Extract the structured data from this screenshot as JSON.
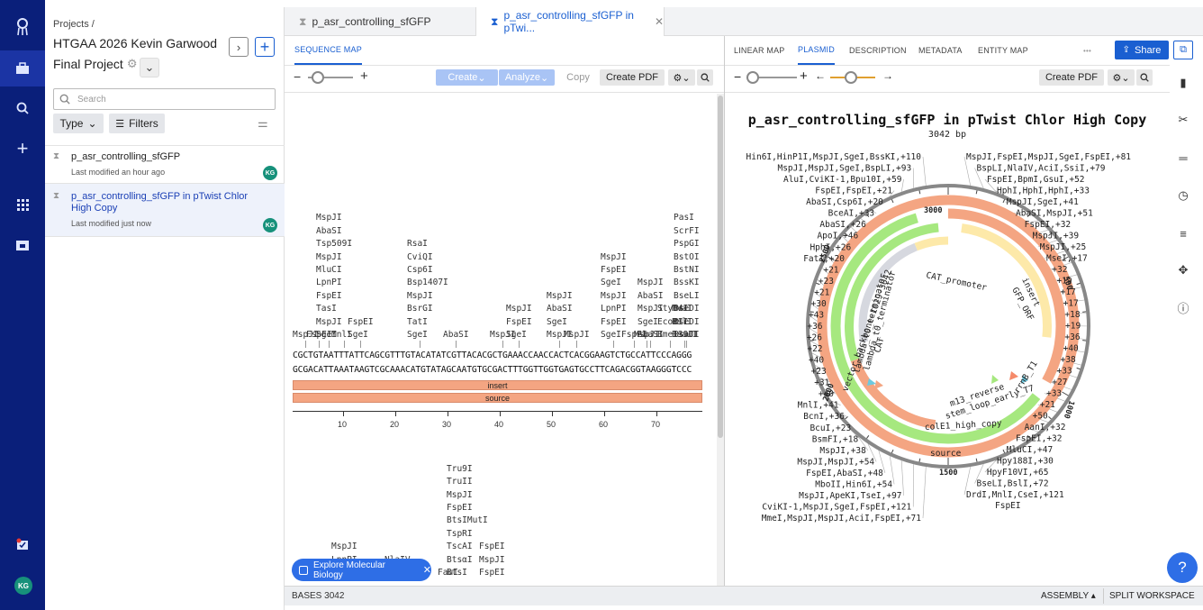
{
  "nav": {
    "items": [
      "logo-icon",
      "briefcase-icon",
      "search-icon",
      "plus-icon",
      "apps-icon",
      "folder-icon"
    ],
    "bottom_badge": "KG"
  },
  "project": {
    "breadcrumb": "Projects /",
    "title_line1": "HTGAA 2026 Kevin Garwood",
    "title_line2": "Final Project",
    "search_placeholder": "Search",
    "type_label": "Type",
    "filters_label": "Filters",
    "files": [
      {
        "name": "p_asr_controlling_sfGFP",
        "modified": "Last modified an hour ago",
        "owner": "KG"
      },
      {
        "name": "p_asr_controlling_sfGFP in pTwist Chlor High Copy",
        "modified": "Last modified just now",
        "owner": "KG"
      }
    ]
  },
  "file_tabs": [
    "p_asr_controlling_sfGFP",
    "p_asr_controlling_sfGFP in pTwi..."
  ],
  "left_view": {
    "tab": "SEQUENCE MAP",
    "create": "Create",
    "analyze": "Analyze",
    "copy": "Copy",
    "create_pdf": "Create PDF",
    "seq_top": "CGCTGTAATTTATTCAGCGTTTGTACATATCGTTACACGCTGAAACCAACCACTCACGGAAGTCTGCCATTCCCAGGG",
    "seq_bottom": "GCGACATTAAATAAGTCGCAAACATGTATAGCAATGTGCGACTTTGGTTGGTGAGTGCCTTCAGACGGTAAGGGTCCC",
    "tracks": [
      "insert",
      "source"
    ],
    "ruler": [
      "10",
      "20",
      "30",
      "40",
      "50",
      "60",
      "70"
    ],
    "explore_banner": "Explore Molecular Biology",
    "bases": "BASES 3042"
  },
  "right_view": {
    "tabs": [
      "LINEAR MAP",
      "PLASMID",
      "DESCRIPTION",
      "METADATA",
      "ENTITY MAP"
    ],
    "active_tab": "PLASMID",
    "more": "•••",
    "share": "Share",
    "create_pdf": "Create PDF",
    "title": "p_asr_controlling_sfGFP in pTwist Chlor High Copy",
    "length": "3042 bp",
    "ticks": [
      "3000",
      "500",
      "1000",
      "1500",
      "2000",
      "2500"
    ],
    "features": [
      "insert",
      "GFP_ORF",
      "CAT_promoter",
      "CAT",
      "lambda_t0_terminator",
      "vector_backbone-1029-3042",
      "colE1_high_copy",
      "source",
      "m13_reverse",
      "stem_loop_early_T7",
      "rrnB_T1"
    ],
    "left_labels": [
      "Hin6I,HinP1I,MspJI,SgeI,BssKI,+110",
      "MspJI,MspJI,SgeI,BspLI,+93",
      "AluI,CviKI-1,Bpu10I,+59",
      "FspEI,FspEI,+21",
      "AbaSI,Csp6I,+20",
      "BceAI,+33",
      "AbaSI,+26",
      "ApoI,+46",
      "HphI,+26",
      "FatI,+20",
      "+21",
      "+23",
      "+21",
      "+30",
      "+43",
      "+36",
      "+26",
      "+22",
      "+40",
      "+23",
      "+31",
      "+40",
      "MnlI,+41",
      "BcnI,+36",
      "BcuI,+23",
      "BsmFI,+18",
      "MspJI,+38",
      "MspJI,MspJI,+54",
      "FspEI,AbaSI,+48",
      "MboII,Hin6I,+54",
      "MspJI,ApeKI,TseI,+97",
      "CviKI-1,MspJI,SgeI,FspEI,+121",
      "MmeI,MspJI,MspJI,AciI,FspEI,+71"
    ],
    "right_labels": [
      "MspJI,FspEI,MspJI,SgeI,FspEI,+81",
      "BspLI,NlaIV,AciI,SsiI,+79",
      "FspEI,BpmI,GsuI,+52",
      "HphI,HphI,HphI,+33",
      "MspJI,SgeI,+41",
      "AbaSI,MspJI,+51",
      "FspEI,+32",
      "MspJI,+39",
      "MspJI,+25",
      "MseI,+17",
      "+32",
      "+19",
      "+17",
      "+17",
      "+18",
      "+19",
      "+36",
      "+40",
      "+38",
      "+33",
      "+27",
      "+33",
      "+21",
      "+50",
      "AanI,+32",
      "FspEI,+32",
      "MluCI,+47",
      "Hpy188I,+30",
      "HpyF10VI,+65",
      "BseLI,BslI,+72",
      "DrdI,MnlI,CseI,+121"
    ],
    "bottom_label": "FspEI"
  },
  "footer": {
    "assembly": "ASSEMBLY ▴",
    "split": "SPLIT WORKSPACE"
  },
  "colors": {
    "rail": "#0a1f7a",
    "accent": "#1a5fd1",
    "feature_orange": "#f4a582",
    "feature_green": "#a6e87f",
    "feature_yellow": "#fde9a9",
    "help": "#2e6ee6"
  }
}
